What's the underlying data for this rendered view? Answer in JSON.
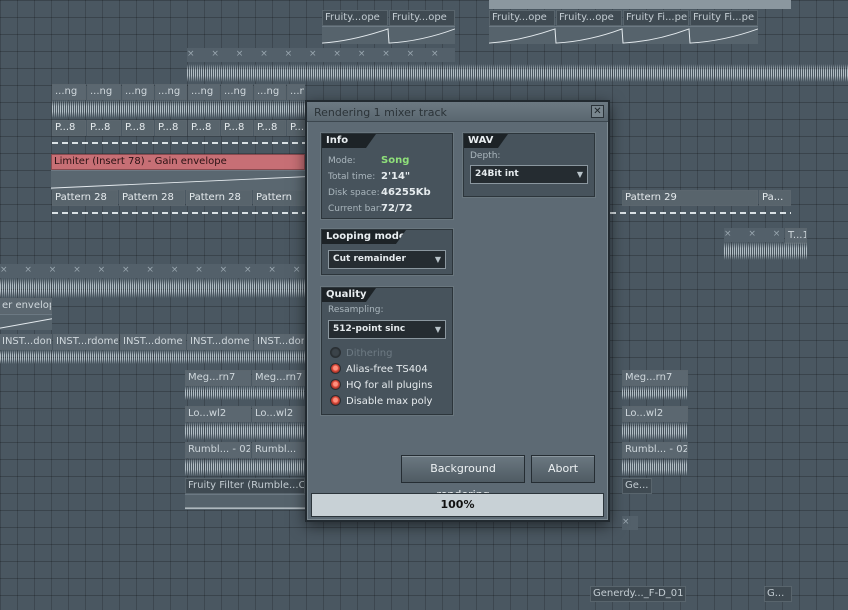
{
  "playlist": {
    "clips": {
      "fruity_ope_1": "Fruity...ope",
      "fruity_ope_2": "Fruity...ope",
      "fruity_ope_3": "Fruity...ope",
      "fruity_ope_4": "Fruity...ope",
      "fruity_ope_5": "Fruity...ope",
      "fruity_fi_pe": "Fruity Fi...pe",
      "ng": "...ng",
      "p8": "P...8",
      "gain_envelope": "Limiter (Insert 78) - Gain envelope",
      "pattern_28": "Pattern 28",
      "pattern_28_cut": "Pattern",
      "pattern_29": "Pattern 29",
      "pa": "Pa...",
      "t1": "T...1",
      "er_envelope": "er envelope",
      "inst_dome_1": "INST...dome",
      "inst_rdome": "INST...rdome",
      "inst_dome_2": "INST...dome",
      "inst_dome_3": "INST...dome",
      "inst_dome_4": "INST...dome",
      "meg_rn7": "Meg...rn7",
      "lo_wl2": "Lo...wl2",
      "rumbl_02": "Rumbl... - 02",
      "rumbl_cut": "Rumbl...",
      "fruity_filter": "Fruity Filter (Rumble...Cu",
      "ge": "Ge...",
      "generdy": "Generdy..._F-D_01",
      "g": "G..."
    }
  },
  "dialog": {
    "title": "Rendering 1 mixer track",
    "close_glyph": "✕",
    "info": {
      "header": "Info",
      "mode_label": "Mode:",
      "mode_value": "Song",
      "total_time_label": "Total time:",
      "total_time_value": "2'14\"",
      "disk_space_label": "Disk space:",
      "disk_space_value": "46255Kb",
      "current_bar_label": "Current bar:",
      "current_bar_value": "72/72"
    },
    "wav": {
      "header": "WAV",
      "depth_label": "Depth:",
      "depth_value": "24Bit int"
    },
    "looping": {
      "header": "Looping mode",
      "value": "Cut remainder"
    },
    "quality": {
      "header": "Quality",
      "resampling_label": "Resampling:",
      "resampling_value": "512-point sinc",
      "options": {
        "dithering": "Dithering",
        "alias_free": "Alias-free TS404",
        "hq_plugins": "HQ for all plugins",
        "disable_max_poly": "Disable max poly"
      }
    },
    "buttons": {
      "background_rendering": "Background rendering",
      "abort": "Abort"
    },
    "progress_text": "100%",
    "progress_value": 1.0
  },
  "icons": {
    "dropdown_arrow": "▼",
    "x_marks": "× × × × × × × × × × × × × × × × × × × ×"
  },
  "colors": {
    "gain_clip": "#c76f75",
    "radio_on": "#d94a3b",
    "song_mode": "#8fe07a"
  }
}
